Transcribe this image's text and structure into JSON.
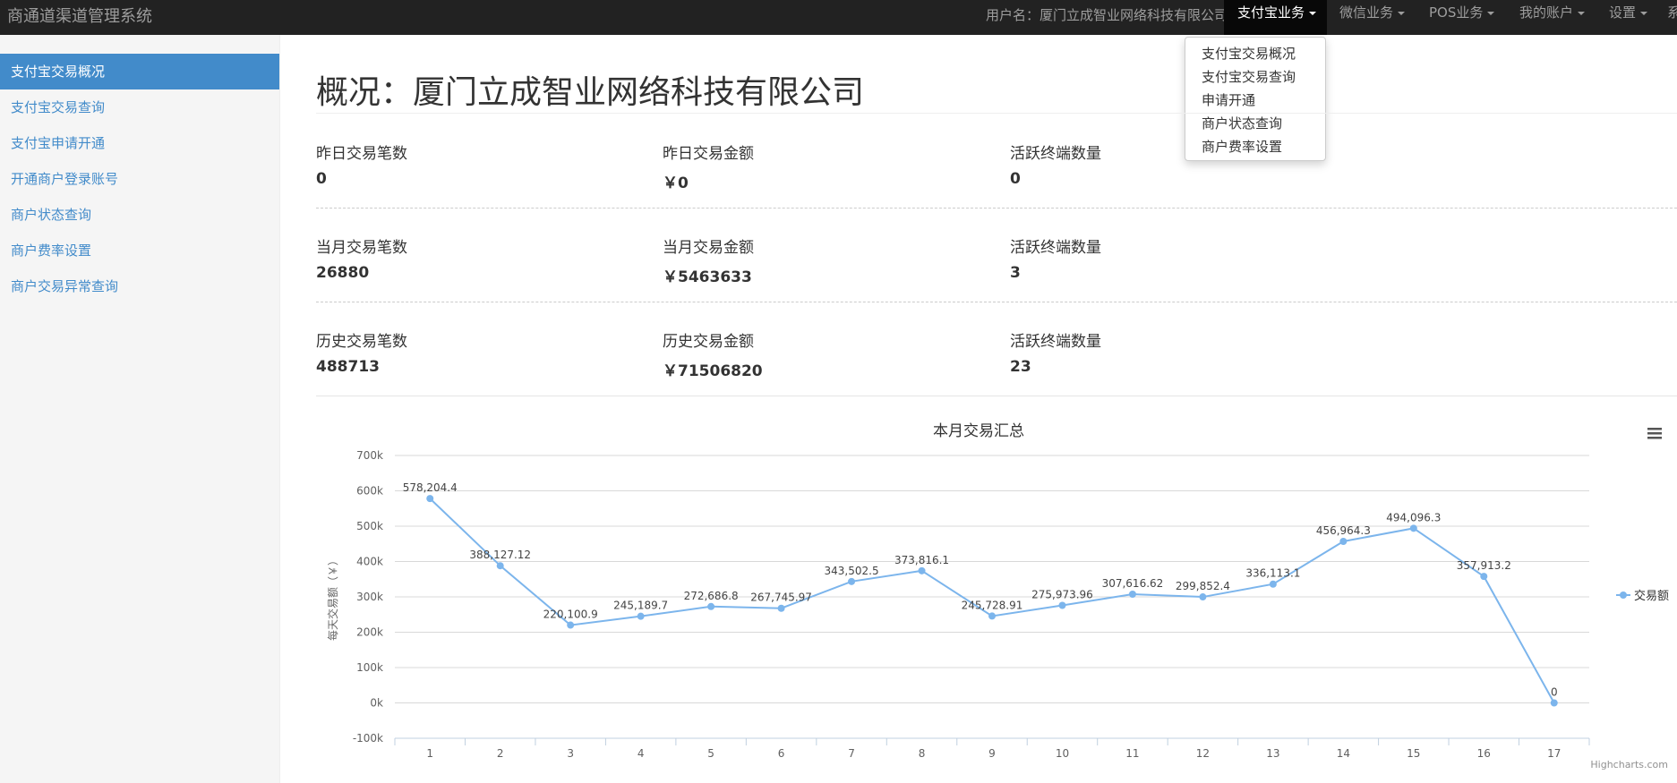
{
  "app": {
    "brand": "商通道渠道管理系统"
  },
  "navbar": {
    "user_label": "用户名：厦门立成智业网络科技有限公司",
    "menus": [
      "支付宝业务",
      "微信业务",
      "POS业务",
      "我的账户",
      "设置"
    ],
    "truncated_menu": "系"
  },
  "dropdown": {
    "items": [
      "支付宝交易概况",
      "支付宝交易查询",
      "申请开通",
      "商户状态查询",
      "商户费率设置"
    ]
  },
  "sidebar": {
    "items": [
      "支付宝交易概况",
      "支付宝交易查询",
      "支付宝申请开通",
      "开通商户登录账号",
      "商户状态查询",
      "商户费率设置",
      "商户交易异常查询"
    ]
  },
  "page": {
    "title": "概况：厦门立成智业网络科技有限公司"
  },
  "stats": {
    "rows": [
      {
        "count_label": "昨日交易笔数",
        "count": "0",
        "amount_label": "昨日交易金额",
        "amount": "￥0",
        "terminals_label": "活跃终端数量",
        "terminals": "0"
      },
      {
        "count_label": "当月交易笔数",
        "count": "26880",
        "amount_label": "当月交易金额",
        "amount": "￥5463633",
        "terminals_label": "活跃终端数量",
        "terminals": "3"
      },
      {
        "count_label": "历史交易笔数",
        "count": "488713",
        "amount_label": "历史交易金额",
        "amount": "￥71506820",
        "terminals_label": "活跃终端数量",
        "terminals": "23"
      }
    ]
  },
  "chart_data": {
    "type": "line",
    "title": "本月交易汇总",
    "ylabel": "每天交易额（￥）",
    "xlabel": "",
    "ylim": [
      -100000,
      700000
    ],
    "yticks": [
      -100000,
      0,
      100000,
      200000,
      300000,
      400000,
      500000,
      600000,
      700000
    ],
    "ytick_labels": [
      "-100k",
      "0k",
      "100k",
      "200k",
      "300k",
      "400k",
      "500k",
      "600k",
      "700k"
    ],
    "categories": [
      "1",
      "2",
      "3",
      "4",
      "5",
      "6",
      "7",
      "8",
      "9",
      "10",
      "11",
      "12",
      "13",
      "14",
      "15",
      "16",
      "17"
    ],
    "series": [
      {
        "name": "交易额",
        "values": [
          578204.4,
          388127.12,
          220100.9,
          245189.7,
          272686.8,
          267745.97,
          343502.5,
          373816.1,
          245728.91,
          275973.96,
          307616.62,
          299852.4,
          336113.1,
          456964.3,
          494096.3,
          357913.2,
          0
        ],
        "labels": [
          "578,204.4",
          "388,127.12",
          "220,100.9",
          "245,189.7",
          "272,686.8",
          "267,745.97",
          "343,502.5",
          "373,816.1",
          "245,728.91",
          "275,973.96",
          "307,616.62",
          "299,852.4",
          "336,113.1",
          "456,964.3",
          "494,096.3",
          "357,913.2",
          "0"
        ]
      }
    ],
    "legend_position": "right",
    "grid": true,
    "credits": "Highcharts.com",
    "color": "#7cb5ec"
  }
}
